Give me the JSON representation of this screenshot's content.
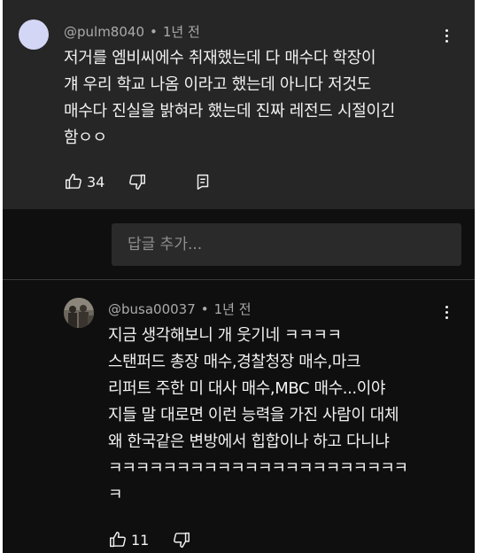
{
  "comment_main": {
    "author": "@pulm8040",
    "separator": "•",
    "time": "1년 전",
    "lines": [
      "저거를 엠비씨에수 취재했는데 다 매수다 학장이",
      "걔 우리 학교 나옴 이라고 했는데 아니다 저것도",
      "매수다 진실을 밝혀라 했는데 진짜 레전드 시절이긴",
      "함ㅇㅇ"
    ],
    "likes": "34",
    "icons": {
      "menu": "kebab-menu-icon",
      "like": "thumbs-up-icon",
      "dislike": "thumbs-down-icon",
      "reply": "reply-icon"
    }
  },
  "reply_input": {
    "placeholder": "답글 추가..."
  },
  "comment_reply": {
    "author": "@busa00037",
    "separator": "•",
    "time": "1년 전",
    "lines": [
      "지금 생각해보니 개 웃기네 ㅋㅋㅋㅋ",
      "스탠퍼드 총장 매수,경찰청장 매수,마크",
      "리퍼트 주한 미 대사 매수,MBC 매수...이야",
      "지들 말 대로면 이런 능력을 가진 사람이 대체",
      "왜 한국같은 변방에서 힙합이나 하고 다니냐",
      "ㅋㅋㅋㅋㅋㅋㅋㅋㅋㅋㅋㅋㅋㅋㅋㅋㅋㅋㅋㅋㅋㅋ",
      "ㅋ"
    ],
    "likes": "11"
  },
  "colors": {
    "background": "#0f0f0f",
    "highlight": "#262626",
    "text": "#f1f1f1",
    "meta": "#aaaaaa",
    "input_bg": "#2a2a2a",
    "avatar_1": "#d3d6f4"
  }
}
